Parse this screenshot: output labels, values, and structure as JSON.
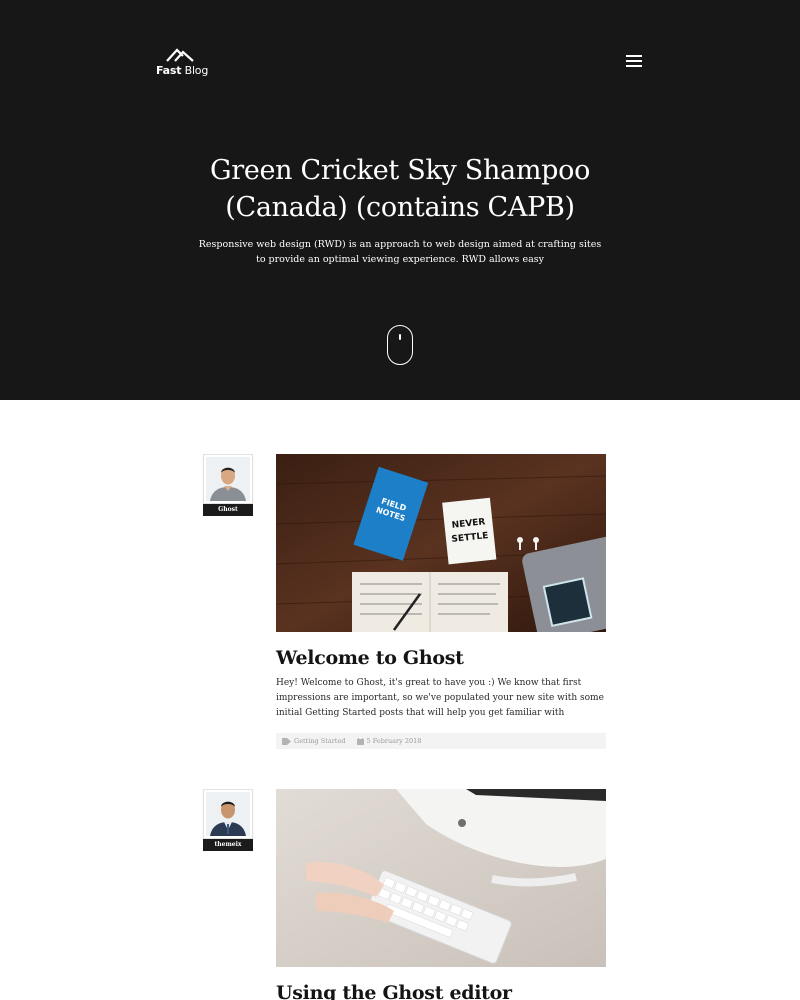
{
  "header": {
    "logo_bold": "Fast",
    "logo_light": "Blog",
    "menu_icon": "hamburger-icon"
  },
  "hero": {
    "title_line1": "Green Cricket Sky Shampoo",
    "title_line2": "(Canada) (contains CAPB)",
    "subtitle": "Responsive web design (RWD) is an approach to web design aimed at crafting sites to provide an optimal viewing experience. RWD allows easy",
    "scroll_icon": "mouse-scroll-icon"
  },
  "posts": [
    {
      "author": "Ghost",
      "title": "Welcome to Ghost",
      "excerpt": "Hey! Welcome to Ghost, it's great to have you :) We know that first impressions are important, so we've populated your new site with some initial Getting Started posts that will help you get familiar with",
      "tag": "Getting Started",
      "date": "5 February 2018"
    },
    {
      "author": "themeix",
      "title": "Using the Ghost editor"
    }
  ],
  "colors": {
    "hero_bg": "#181718",
    "author_label_bg": "#1b1b1b",
    "meta_bg": "#f3f3f3"
  }
}
